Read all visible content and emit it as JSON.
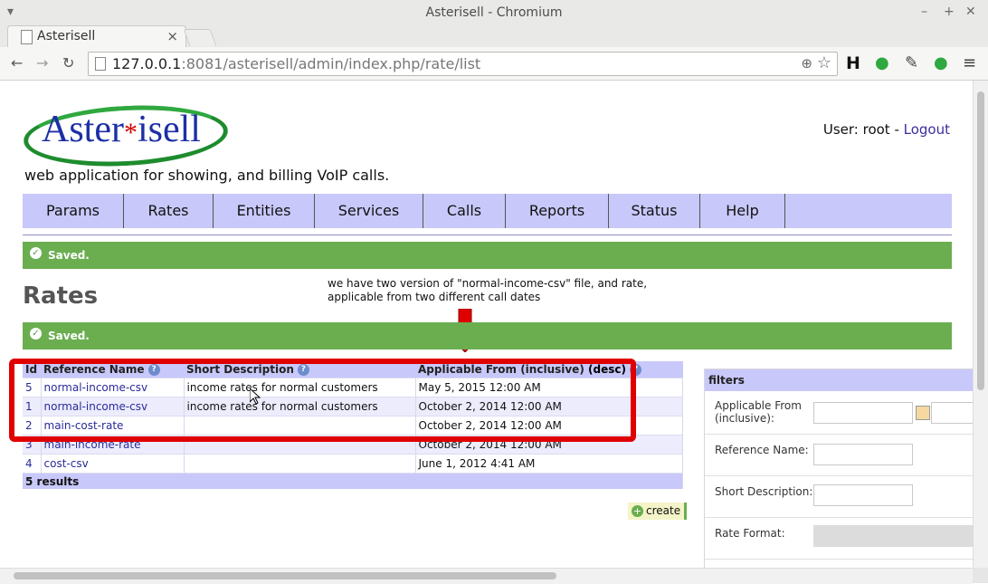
{
  "window": {
    "title": "Asterisell - Chromium",
    "tab_label": "Asterisell",
    "url_host": "127.0.0.1",
    "url_rest": ":8081/asterisell/admin/index.php/rate/list"
  },
  "header": {
    "logo_text_a": "Aster",
    "logo_text_b": "isell",
    "tagline": "web application for showing, and billing VoIP calls.",
    "user_prefix": "User: root - ",
    "logout": "Logout"
  },
  "menu": [
    "Params",
    "Rates",
    "Entities",
    "Services",
    "Calls",
    "Reports",
    "Status",
    "Help"
  ],
  "flash1": "Saved.",
  "flash2": "Saved.",
  "page_title": "Rates",
  "annotation": {
    "line1": "we have two version of \"normal-income-csv\" file, and rate,",
    "line2": "applicable from two different call dates"
  },
  "table": {
    "headers": {
      "id": "Id",
      "ref": "Reference Name",
      "desc": "Short Description",
      "from": "Applicable From (inclusive)",
      "sort": "(desc)"
    },
    "rows": [
      {
        "id": "5",
        "ref": "normal-income-csv",
        "desc": "income rates for normal customers",
        "from": "May 5, 2015 12:00 AM"
      },
      {
        "id": "1",
        "ref": "normal-income-csv",
        "desc": "income rates for normal customers",
        "from": "October 2, 2014 12:00 AM"
      },
      {
        "id": "2",
        "ref": "main-cost-rate",
        "desc": "",
        "from": "October 2, 2014 12:00 AM"
      },
      {
        "id": "3",
        "ref": "main-income-rate",
        "desc": "",
        "from": "October 2, 2014 12:00 AM"
      },
      {
        "id": "4",
        "ref": "cost-csv",
        "desc": "",
        "from": "June 1, 2012 4:41 AM"
      }
    ],
    "footer": "5 results"
  },
  "create_label": "create",
  "filters": {
    "title": "filters",
    "applicable_from": "Applicable From (inclusive):",
    "reference_name": "Reference Name:",
    "short_description": "Short Description:",
    "rate_format": "Rate Format:"
  },
  "colors": {
    "menu_bg": "#c8c8fa",
    "flash_bg": "#6aae50",
    "annotation_red": "#e00000"
  }
}
